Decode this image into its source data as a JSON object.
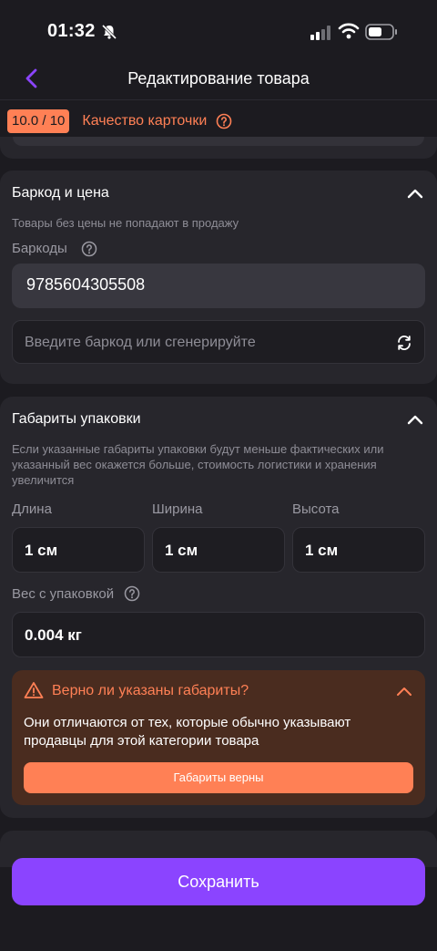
{
  "status_bar": {
    "time": "01:32"
  },
  "header": {
    "title": "Редактирование товара"
  },
  "quality": {
    "badge": "10.0 / 10",
    "label": "Качество карточки"
  },
  "barcode_section": {
    "title": "Баркод и цена",
    "hint": "Товары без цены не попадают в продажу",
    "barcodes_label": "Баркоды",
    "barcode_value": "9785604305508",
    "new_barcode_placeholder": "Введите баркод или сгенерируйте"
  },
  "dimensions_section": {
    "title": "Габариты упаковки",
    "hint": "Если указанные габариты упаковки будут меньше фактических или указанный вес окажется больше, стоимость логистики и хранения увеличится",
    "length_label": "Длина",
    "length_value": "1 см",
    "width_label": "Ширина",
    "width_value": "1 см",
    "height_label": "Высота",
    "height_value": "1 см",
    "weight_label": "Вес с упаковкой",
    "weight_value": "0.004 кг"
  },
  "warning": {
    "title": "Верно ли указаны габариты?",
    "text": "Они отличаются от тех, которые обычно указывают продавцы для этой категории товара",
    "button": "Габариты верны"
  },
  "save_button": "Сохранить",
  "colors": {
    "background": "#1c1b20",
    "card": "#27262c",
    "accent_orange": "#ff8055",
    "primary_purple": "#8b44ff",
    "warning_bg": "#4a2c1f"
  }
}
